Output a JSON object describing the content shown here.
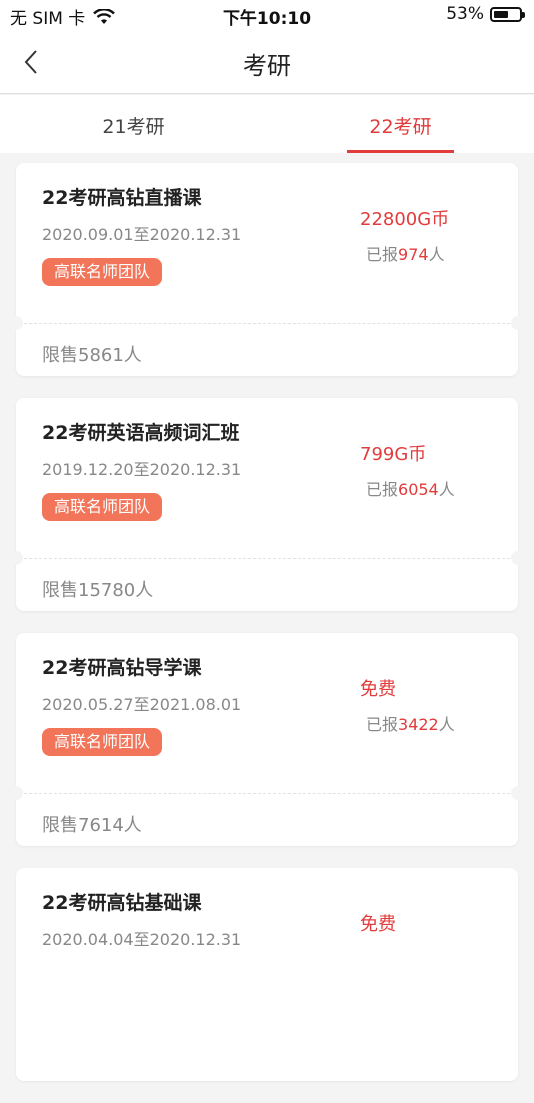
{
  "status_bar": {
    "carrier": "无 SIM 卡",
    "time": "下午10:10",
    "battery": "53%"
  },
  "nav": {
    "title": "考研"
  },
  "tabs": [
    {
      "label": "21考研",
      "active": false
    },
    {
      "label": "22考研",
      "active": true
    }
  ],
  "courses": [
    {
      "name": "22考研高钻直播课",
      "dates": "2020.09.01至2020.12.31",
      "tag": "高联名师团队",
      "price": "22800G币",
      "enrolled_prefix": "已报",
      "enrolled_count": "974",
      "enrolled_suffix": "人",
      "limit": "限售5861人"
    },
    {
      "name": "22考研英语高频词汇班",
      "dates": "2019.12.20至2020.12.31",
      "tag": "高联名师团队",
      "price": "799G币",
      "enrolled_prefix": "已报",
      "enrolled_count": "6054",
      "enrolled_suffix": "人",
      "limit": "限售15780人"
    },
    {
      "name": "22考研高钻导学课",
      "dates": "2020.05.27至2021.08.01",
      "tag": "高联名师团队",
      "price": "免费",
      "enrolled_prefix": "已报",
      "enrolled_count": "3422",
      "enrolled_suffix": "人",
      "limit": "限售7614人"
    },
    {
      "name": "22考研高钻基础课",
      "dates": "2020.04.04至2020.12.31",
      "tag": "",
      "price": "免费",
      "enrolled_prefix": "",
      "enrolled_count": "",
      "enrolled_suffix": "",
      "limit": ""
    }
  ],
  "colors": {
    "accent": "#e23b3b",
    "tag_bg": "#f27459"
  }
}
